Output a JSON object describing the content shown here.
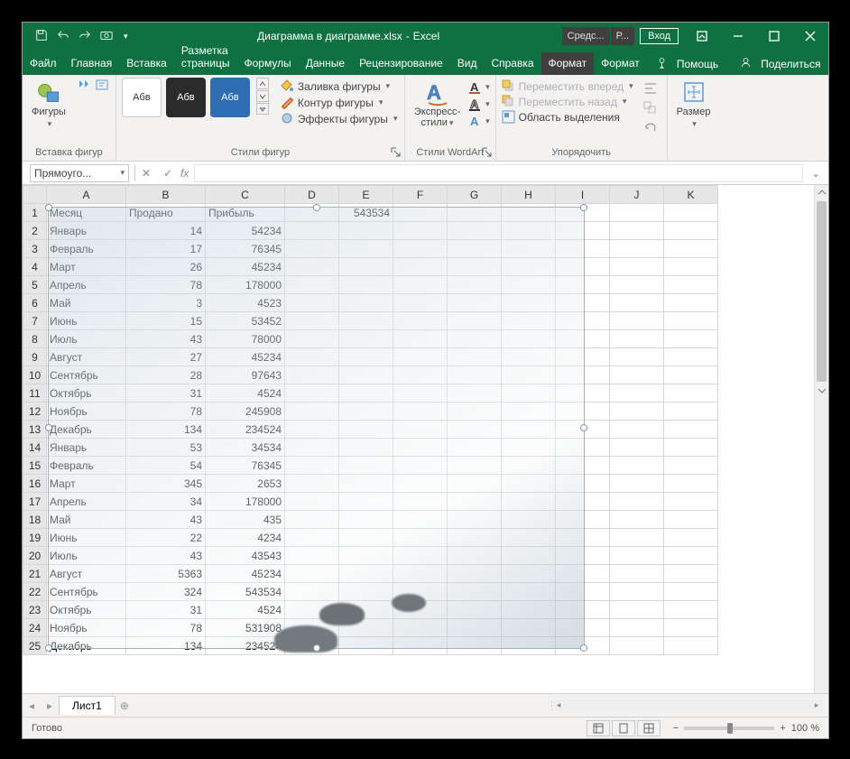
{
  "title": {
    "doc": "Диаграмма в диаграмме.xlsx",
    "sep": " - ",
    "app": "Excel"
  },
  "qat": {
    "save": "save-icon",
    "undo": "undo-icon",
    "redo": "redo-icon",
    "camera": "camera-icon"
  },
  "contextual_tabs": {
    "a": "Средс...",
    "b": "Р..."
  },
  "login_label": "Вход",
  "ribbon_tabs": [
    "Файл",
    "Главная",
    "Вставка",
    "Разметка страницы",
    "Формулы",
    "Данные",
    "Рецензирование",
    "Вид",
    "Справка"
  ],
  "context_tabs": [
    "Формат",
    "Формат"
  ],
  "tell_me": "Помощь",
  "share": "Поделиться",
  "ribbon": {
    "insert_shapes": {
      "big": "Фигуры",
      "label": "Вставка фигур"
    },
    "shape_styles": {
      "preview_text": "Абв",
      "fill": "Заливка фигуры",
      "outline": "Контур фигуры",
      "effects": "Эффекты фигуры",
      "label": "Стили фигур"
    },
    "wordart": {
      "big_line1": "Экспресс-",
      "big_line2": "стили",
      "label": "Стили WordArt"
    },
    "arrange": {
      "fwd": "Переместить вперед",
      "back": "Переместить назад",
      "pane": "Область выделения",
      "label": "Упорядочить"
    },
    "size": {
      "big": "Размер"
    }
  },
  "name_box": "Прямоуго...",
  "formula": "",
  "columns": [
    "A",
    "B",
    "C",
    "D",
    "E",
    "F",
    "G",
    "H",
    "I",
    "J",
    "K"
  ],
  "headers": [
    "Месяц",
    "Продано",
    "Прибыль"
  ],
  "e1": "543534",
  "rows": [
    [
      "Январь",
      "14",
      "54234"
    ],
    [
      "Февраль",
      "17",
      "76345"
    ],
    [
      "Март",
      "26",
      "45234"
    ],
    [
      "Апрель",
      "78",
      "178000"
    ],
    [
      "Май",
      "3",
      "4523"
    ],
    [
      "Июнь",
      "15",
      "53452"
    ],
    [
      "Июль",
      "43",
      "78000"
    ],
    [
      "Август",
      "27",
      "45234"
    ],
    [
      "Сентябрь",
      "28",
      "97643"
    ],
    [
      "Октябрь",
      "31",
      "4524"
    ],
    [
      "Ноябрь",
      "78",
      "245908"
    ],
    [
      "Декабрь",
      "134",
      "234524"
    ],
    [
      "Январь",
      "53",
      "34534"
    ],
    [
      "Февраль",
      "54",
      "76345"
    ],
    [
      "Март",
      "345",
      "2653"
    ],
    [
      "Апрель",
      "34",
      "178000"
    ],
    [
      "Май",
      "43",
      "435"
    ],
    [
      "Июнь",
      "22",
      "4234"
    ],
    [
      "Июль",
      "43",
      "43543"
    ],
    [
      "Август",
      "5363",
      "45234"
    ],
    [
      "Сентябрь",
      "324",
      "543534"
    ],
    [
      "Октябрь",
      "31",
      "4524"
    ],
    [
      "Ноябрь",
      "78",
      "531908"
    ],
    [
      "Декабрь",
      "134",
      "234524"
    ]
  ],
  "sheet_tab": "Лист1",
  "status_text": "Готово",
  "zoom": "100 %"
}
